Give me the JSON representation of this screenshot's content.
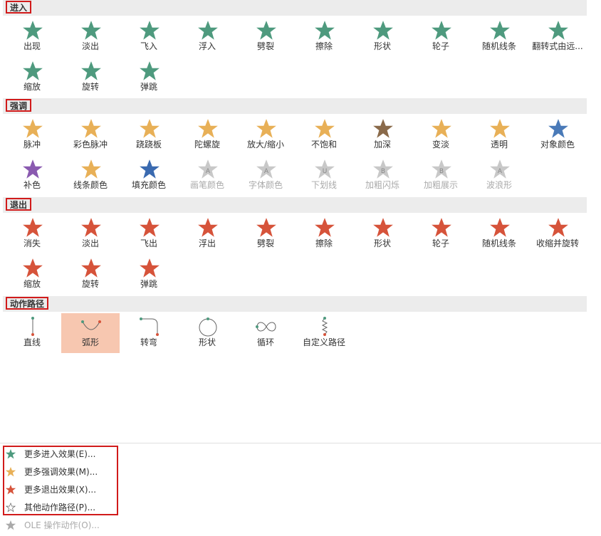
{
  "sections": {
    "entrance": {
      "title": "进入",
      "items": [
        "出现",
        "淡出",
        "飞入",
        "浮入",
        "劈裂",
        "擦除",
        "形状",
        "轮子",
        "随机线条",
        "翻转式由远...",
        "缩放",
        "旋转",
        "弹跳"
      ]
    },
    "emphasis": {
      "title": "强调",
      "items": [
        "脉冲",
        "彩色脉冲",
        "跷跷板",
        "陀螺旋",
        "放大/缩小",
        "不饱和",
        "加深",
        "变淡",
        "透明",
        "对象颜色",
        "补色",
        "线条颜色",
        "填充颜色",
        "画笔颜色",
        "字体颜色",
        "下划线",
        "加粗闪烁",
        "加粗展示",
        "波浪形"
      ],
      "disabled_items": [
        "画笔颜色",
        "字体颜色",
        "下划线",
        "加粗闪烁",
        "加粗展示",
        "波浪形"
      ]
    },
    "exit": {
      "title": "退出",
      "items": [
        "消失",
        "淡出",
        "飞出",
        "浮出",
        "劈裂",
        "擦除",
        "形状",
        "轮子",
        "随机线条",
        "收缩并旋转",
        "缩放",
        "旋转",
        "弹跳"
      ]
    },
    "motion": {
      "title": "动作路径",
      "items": [
        "直线",
        "弧形",
        "转弯",
        "形状",
        "循环",
        "自定义路径"
      ],
      "selected": "弧形"
    }
  },
  "menu": [
    {
      "label": "更多进入效果(E)...",
      "icon": "green-star-icon"
    },
    {
      "label": "更多强调效果(M)...",
      "icon": "gold-star-icon"
    },
    {
      "label": "更多退出效果(X)...",
      "icon": "red-star-icon"
    },
    {
      "label": "其他动作路径(P)...",
      "icon": "outline-star-icon"
    },
    {
      "label": "OLE 操作动作(O)...",
      "icon": "ole-icon",
      "disabled": true
    }
  ],
  "colors": {
    "entrance": "#4e9a7e",
    "emphasis": "#e8b057",
    "exit": "#d6533a",
    "disabled": "#c8c8c8",
    "selected_bg": "#f7c7b0",
    "highlight_border": "#d11b1b"
  }
}
